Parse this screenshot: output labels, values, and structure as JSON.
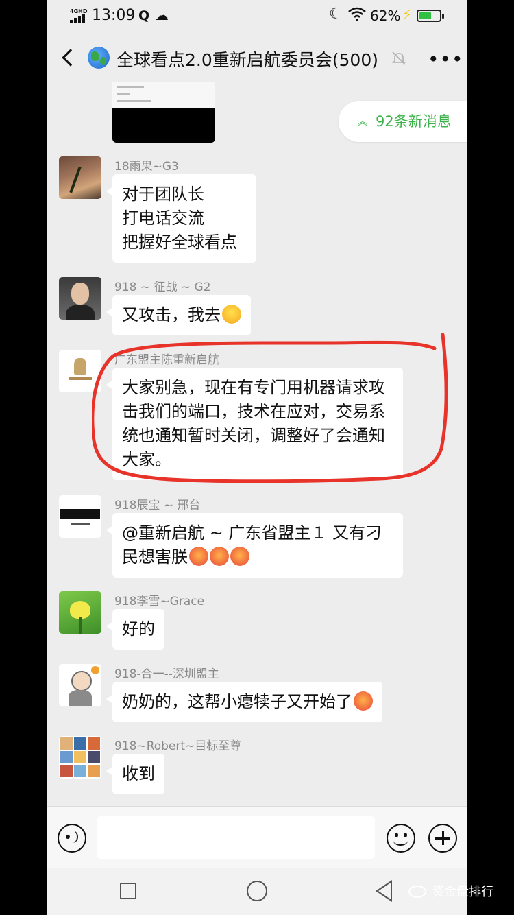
{
  "status_bar": {
    "network": "4GHD",
    "time": "13:09",
    "battery_percent": "62%",
    "battery_level": 0.62,
    "icons": [
      "signal-icon",
      "q-icon",
      "cloud-icon",
      "moon-icon",
      "wifi-icon",
      "bolt-icon",
      "battery-icon"
    ]
  },
  "nav": {
    "title": "全球看点2.0重新启航委员会(500)",
    "icons": [
      "back-icon",
      "globe-icon",
      "mute-icon",
      "more-icon"
    ]
  },
  "new_messages": {
    "label": "92条新消息"
  },
  "messages": [
    {
      "sender": "18雨果~G3",
      "lines": [
        "对于团队长",
        "打电话交流",
        "把握好全球看点"
      ]
    },
    {
      "sender": "918 ~ 征战 ~ G2",
      "text": "又攻击，我去"
    },
    {
      "sender": "广东盟主陈重新启航",
      "text": "大家别急，现在有专门用机器请求攻击我们的端口，技术在应对，交易系统也通知暂时关闭，调整好了会通知大家。"
    },
    {
      "sender": "918辰宝 ~ 邢台",
      "line1": "@重新启航 ~ 广东省盟主１ 又有刁",
      "line2": "民想害朕"
    },
    {
      "sender": "918李雪~Grace",
      "text": "好的"
    },
    {
      "sender": "918-合一--深圳盟主",
      "text": "奶奶的，这帮小瘪犊子又开始了"
    },
    {
      "sender": "918~Robert~目标至尊",
      "text": "收到"
    }
  ],
  "input": {
    "placeholder": ""
  },
  "watermark": {
    "text": "资金盘排行"
  },
  "colors": {
    "accent_green": "#3bb24a",
    "annotation_red": "#e8332a",
    "chat_bg": "#ededed"
  }
}
